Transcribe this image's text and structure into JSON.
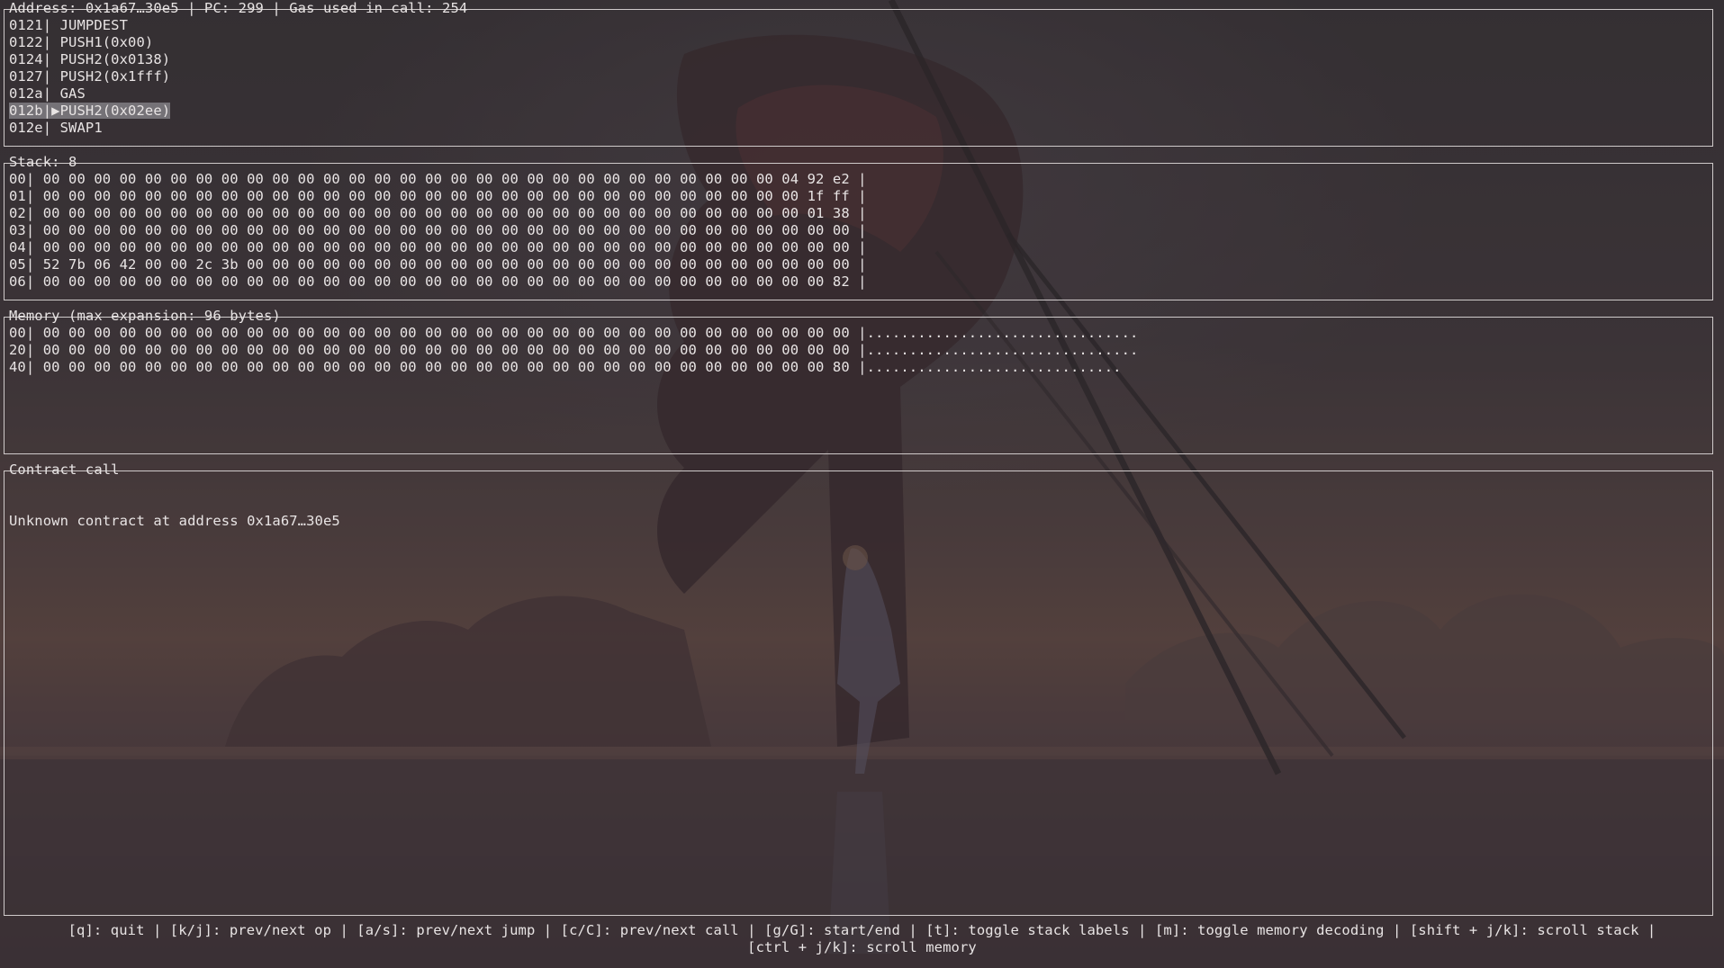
{
  "code_panel": {
    "title": "Address: 0x1a67…30e5 | PC: 299 | Gas used in call: 254",
    "lines": [
      {
        "offset": "0121",
        "sep": "| ",
        "op": "JUMPDEST"
      },
      {
        "offset": "0122",
        "sep": "| ",
        "op": "PUSH1(0x00)"
      },
      {
        "offset": "0124",
        "sep": "| ",
        "op": "PUSH2(0x0138)"
      },
      {
        "offset": "0127",
        "sep": "| ",
        "op": "PUSH2(0x1fff)"
      },
      {
        "offset": "012a",
        "sep": "| ",
        "op": "GAS"
      },
      {
        "offset": "012b",
        "sep": "|▶",
        "op": "PUSH2(0x02ee)",
        "current": true
      },
      {
        "offset": "012e",
        "sep": "| ",
        "op": "SWAP1"
      }
    ]
  },
  "stack_panel": {
    "title": "Stack: 8",
    "rows": [
      "00| 00 00 00 00 00 00 00 00 00 00 00 00 00 00 00 00 00 00 00 00 00 00 00 00 00 00 00 00 00 04 92 e2 |",
      "01| 00 00 00 00 00 00 00 00 00 00 00 00 00 00 00 00 00 00 00 00 00 00 00 00 00 00 00 00 00 00 1f ff |",
      "02| 00 00 00 00 00 00 00 00 00 00 00 00 00 00 00 00 00 00 00 00 00 00 00 00 00 00 00 00 00 00 01 38 |",
      "03| 00 00 00 00 00 00 00 00 00 00 00 00 00 00 00 00 00 00 00 00 00 00 00 00 00 00 00 00 00 00 00 00 |",
      "04| 00 00 00 00 00 00 00 00 00 00 00 00 00 00 00 00 00 00 00 00 00 00 00 00 00 00 00 00 00 00 00 00 |",
      "05| 52 7b 06 42 00 00 2c 3b 00 00 00 00 00 00 00 00 00 00 00 00 00 00 00 00 00 00 00 00 00 00 00 00 |",
      "06| 00 00 00 00 00 00 00 00 00 00 00 00 00 00 00 00 00 00 00 00 00 00 00 00 00 00 00 00 00 00 00 82 |"
    ]
  },
  "memory_panel": {
    "title": "Memory (max expansion: 96 bytes)",
    "rows": [
      "00| 00 00 00 00 00 00 00 00 00 00 00 00 00 00 00 00 00 00 00 00 00 00 00 00 00 00 00 00 00 00 00 00 |................................",
      "20| 00 00 00 00 00 00 00 00 00 00 00 00 00 00 00 00 00 00 00 00 00 00 00 00 00 00 00 00 00 00 00 00 |................................",
      "40| 00 00 00 00 00 00 00 00 00 00 00 00 00 00 00 00 00 00 00 00 00 00 00 00 00 00 00 00 00 00 00 80 |.............................."
    ]
  },
  "contract_panel": {
    "title": "Contract call",
    "message": "Unknown contract at address 0x1a67…30e5"
  },
  "footer": {
    "keybindings": "[q]: quit | [k/j]: prev/next op | [a/s]: prev/next jump | [c/C]: prev/next call | [g/G]: start/end | [t]: toggle stack labels | [m]: toggle memory decoding | [shift + j/k]: scroll stack |\n[ctrl + j/k]: scroll memory"
  },
  "colors": {
    "text": "#e8e4e4",
    "border": "#cfcaca",
    "highlight": "#a9a9ae"
  }
}
